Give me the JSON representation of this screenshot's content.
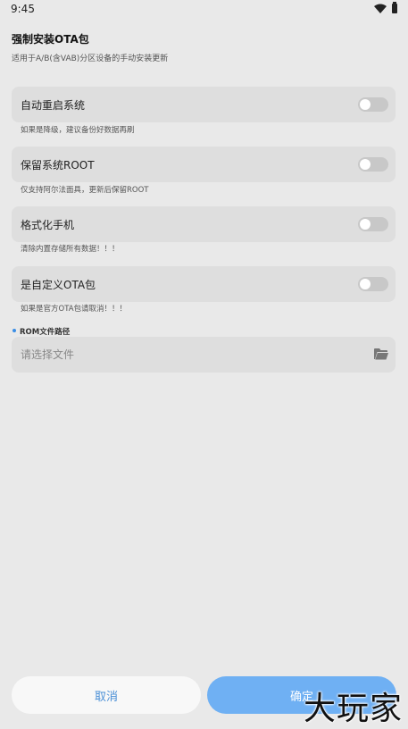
{
  "status_bar": {
    "time": "9:45",
    "wifi_icon": "wifi-icon",
    "battery_icon": "battery-icon"
  },
  "header": {
    "title": "强制安装OTA包",
    "subtitle": "适用于A/B(含VAB)分区设备的手动安装更新"
  },
  "options": [
    {
      "label": "自动重启系统",
      "hint": "如果是降级，建议备份好数据再刷",
      "enabled": false
    },
    {
      "label": "保留系统ROOT",
      "hint": "仅支持阿尔法面具，更新后保留ROOT",
      "enabled": false
    },
    {
      "label": "格式化手机",
      "hint": "清除内置存储所有数据！！！",
      "enabled": false
    },
    {
      "label": "是自定义OTA包",
      "hint": "如果是官方OTA包请取消！！！",
      "enabled": false
    }
  ],
  "rom_field": {
    "label": "ROM文件路径",
    "placeholder": "请选择文件",
    "value": "",
    "icon": "folder-open-icon"
  },
  "buttons": {
    "cancel": "取消",
    "confirm": "确定"
  },
  "watermark": "大玩家",
  "colors": {
    "accent": "#6fb0f3",
    "cancel_text": "#4a8fd6",
    "background": "#e9e9e9"
  }
}
